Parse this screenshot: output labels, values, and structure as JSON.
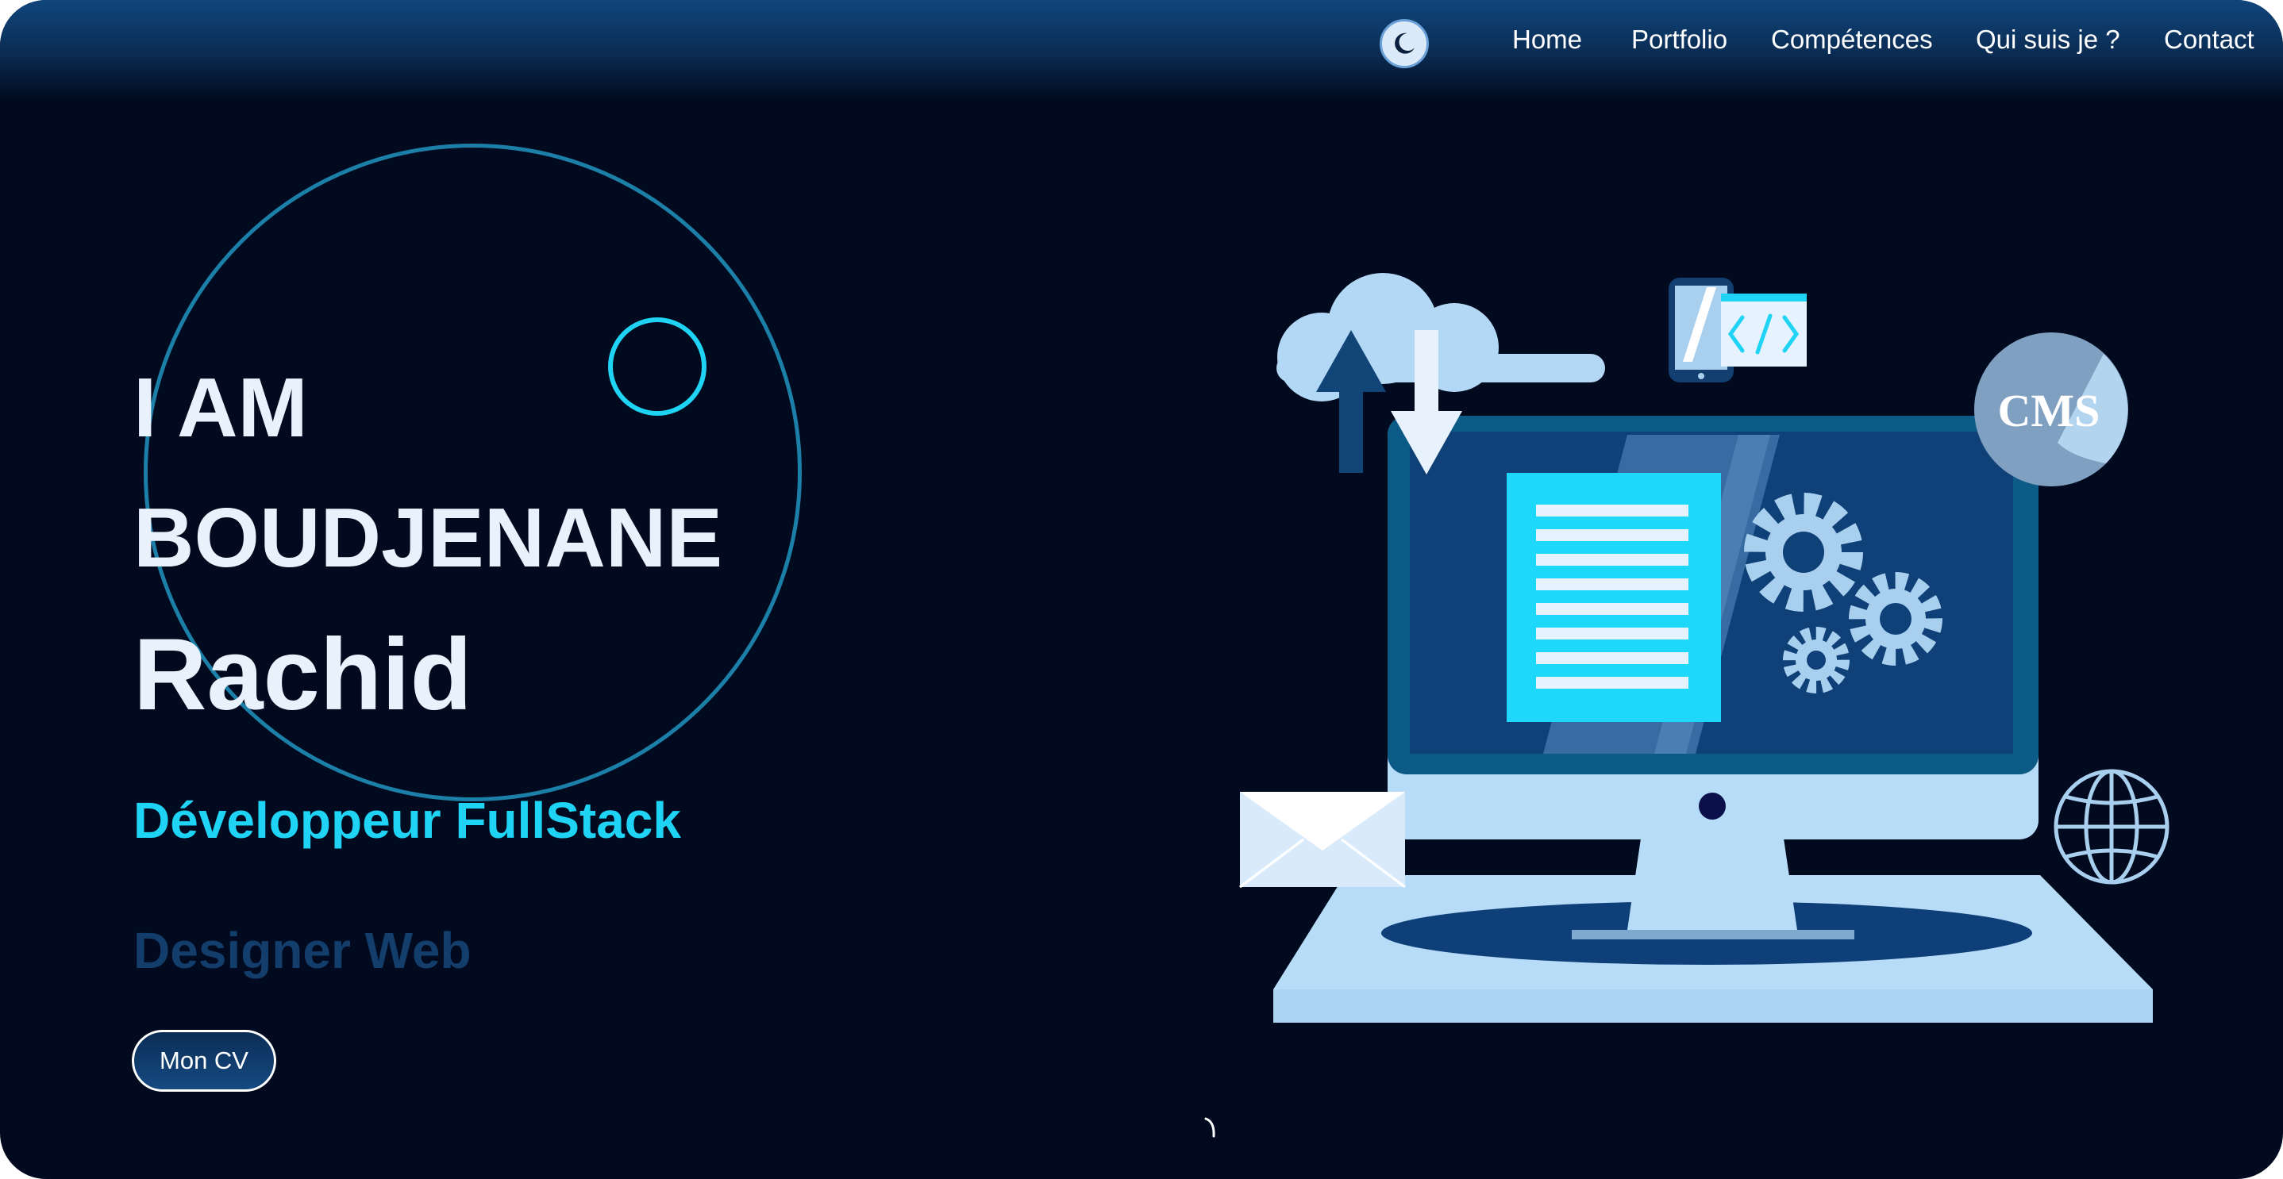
{
  "header": {
    "theme_toggle_icon": "moon-icon",
    "nav": [
      "Home",
      "Portfolio",
      "Compétences",
      "Qui suis je ?",
      "Contact"
    ]
  },
  "hero": {
    "line1": "I AM",
    "line2": "BOUDJENANE",
    "line3": "Rachid",
    "role_primary": "Développeur FullStack",
    "role_secondary": "Designer Web",
    "cv_button": "Mon CV"
  },
  "illustration": {
    "badge": "CMS",
    "code_tag": "</>",
    "icons": [
      "cloud-icon",
      "upload-arrow-icon",
      "download-arrow-icon",
      "phone-icon",
      "code-window-icon",
      "cms-badge-icon",
      "monitor-icon",
      "document-icon",
      "gear-icon",
      "envelope-icon",
      "globe-icon"
    ]
  },
  "colors": {
    "background": "#010a1e",
    "accent_cyan": "#1ed3f4",
    "accent_dark_blue": "#133d6b",
    "header_blue": "#10467c",
    "text_light": "#e8f1fc"
  }
}
